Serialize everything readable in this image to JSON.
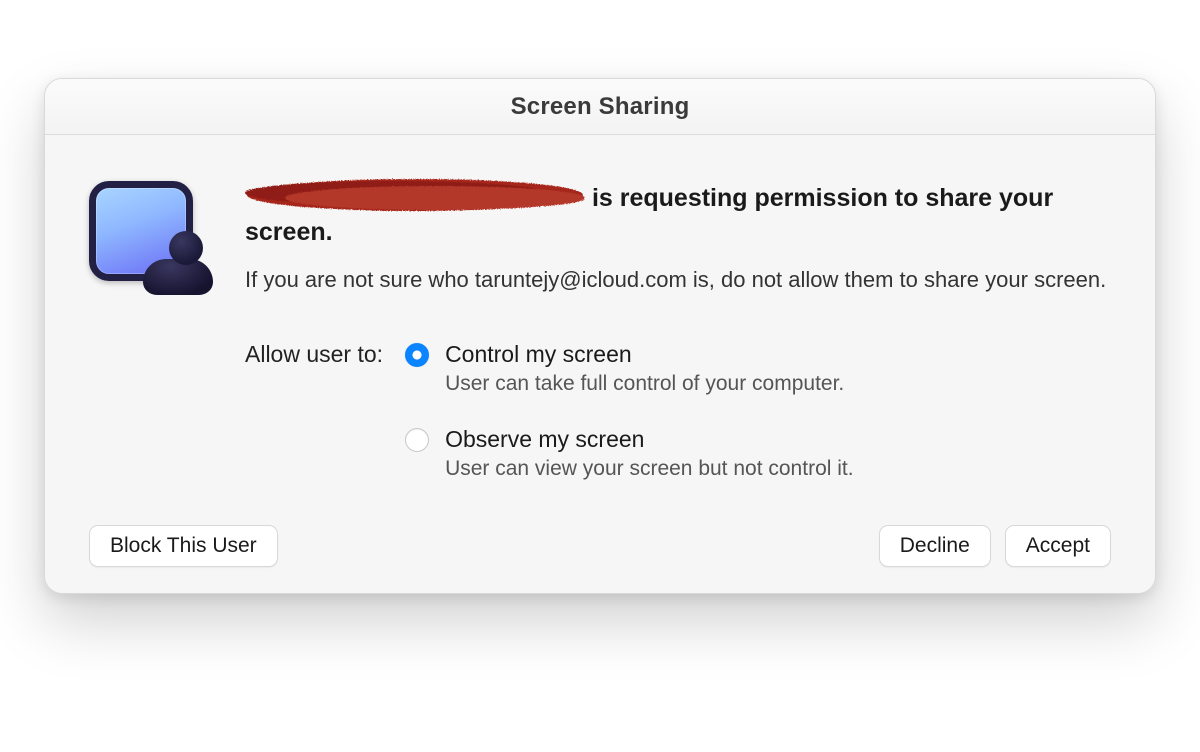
{
  "dialog": {
    "title": "Screen Sharing",
    "requester_email": "taruntejy@icloud.com",
    "headline_prefix_redacted": true,
    "headline_suffix": " is requesting permission to share your screen.",
    "warning_prefix": "If you are not sure who ",
    "warning_suffix": " is, do not allow them to share your screen.",
    "allow_label": "Allow user to:",
    "options": [
      {
        "title": "Control my screen",
        "description": "User can take full control of your computer.",
        "selected": true
      },
      {
        "title": "Observe my screen",
        "description": "User can view your screen but not control it.",
        "selected": false
      }
    ],
    "buttons": {
      "block": "Block This User",
      "decline": "Decline",
      "accept": "Accept"
    }
  }
}
